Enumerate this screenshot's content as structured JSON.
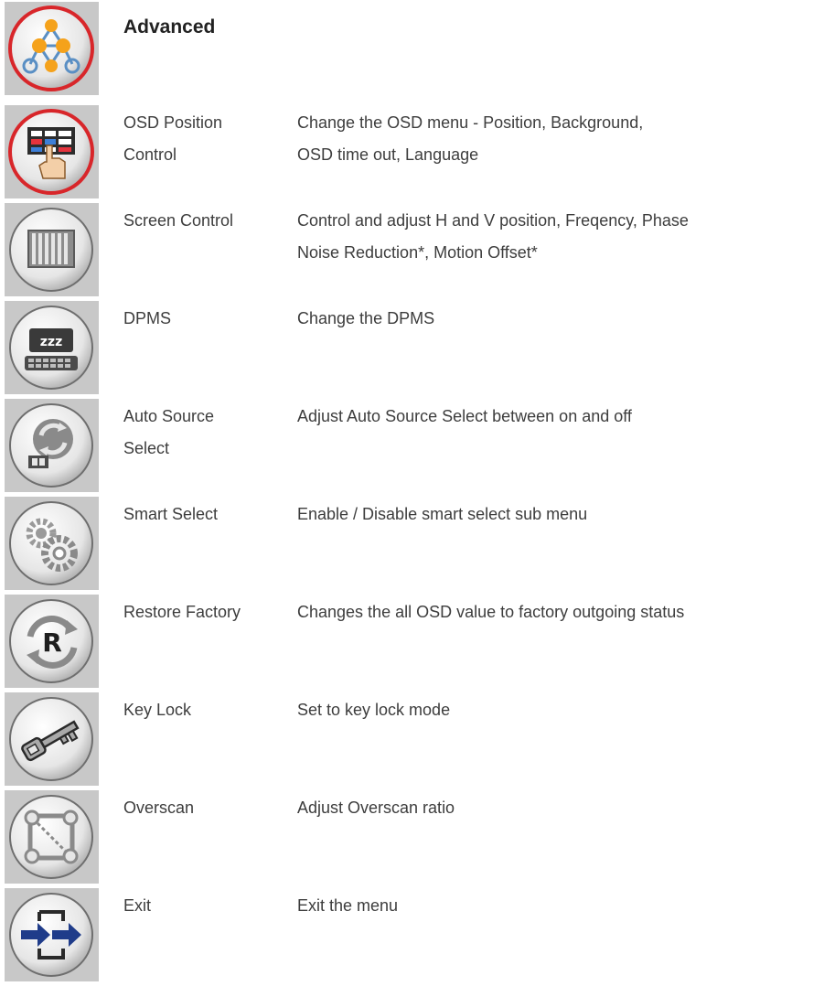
{
  "header": {
    "title": "Advanced",
    "icon": "advanced-network-icon"
  },
  "items": [
    {
      "name_line1": "OSD Position",
      "name_line2": "Control",
      "desc_line1": "Change the OSD menu - Position, Background,",
      "desc_line2": "OSD time out, Language",
      "icon": "osd-position-icon"
    },
    {
      "name_line1": "Screen Control",
      "name_line2": "",
      "desc_line1": "Control and adjust H and V position, Freqency, Phase",
      "desc_line2": "Noise Reduction*, Motion Offset*",
      "icon": "screen-control-icon"
    },
    {
      "name_line1": "DPMS",
      "name_line2": "",
      "desc_line1": "Change the DPMS",
      "desc_line2": "",
      "icon": "dpms-sleep-icon"
    },
    {
      "name_line1": "Auto Source",
      "name_line2": "Select",
      "desc_line1": "Adjust Auto Source Select between on and off",
      "desc_line2": "",
      "icon": "auto-source-icon"
    },
    {
      "name_line1": "Smart Select",
      "name_line2": "",
      "desc_line1": "Enable / Disable smart select sub menu",
      "desc_line2": "",
      "icon": "gears-icon"
    },
    {
      "name_line1": "Restore Factory",
      "name_line2": "",
      "desc_line1": "Changes the all OSD value to factory outgoing status",
      "desc_line2": "",
      "icon": "restore-r-icon"
    },
    {
      "name_line1": "Key Lock",
      "name_line2": "",
      "desc_line1": "Set to key lock mode",
      "desc_line2": "",
      "icon": "key-icon"
    },
    {
      "name_line1": "Overscan",
      "name_line2": "",
      "desc_line1": "Adjust Overscan ratio",
      "desc_line2": "",
      "icon": "overscan-icon"
    },
    {
      "name_line1": "Exit",
      "name_line2": "",
      "desc_line1": "Exit the menu",
      "desc_line2": "",
      "icon": "exit-arrows-icon"
    }
  ],
  "colors": {
    "text": "#3d3d3d",
    "tile_bg": "#c8c8c8",
    "active_ring": "#d8262a",
    "exit_arrow": "#1f3c8a",
    "network_node": "#f5a21b"
  }
}
